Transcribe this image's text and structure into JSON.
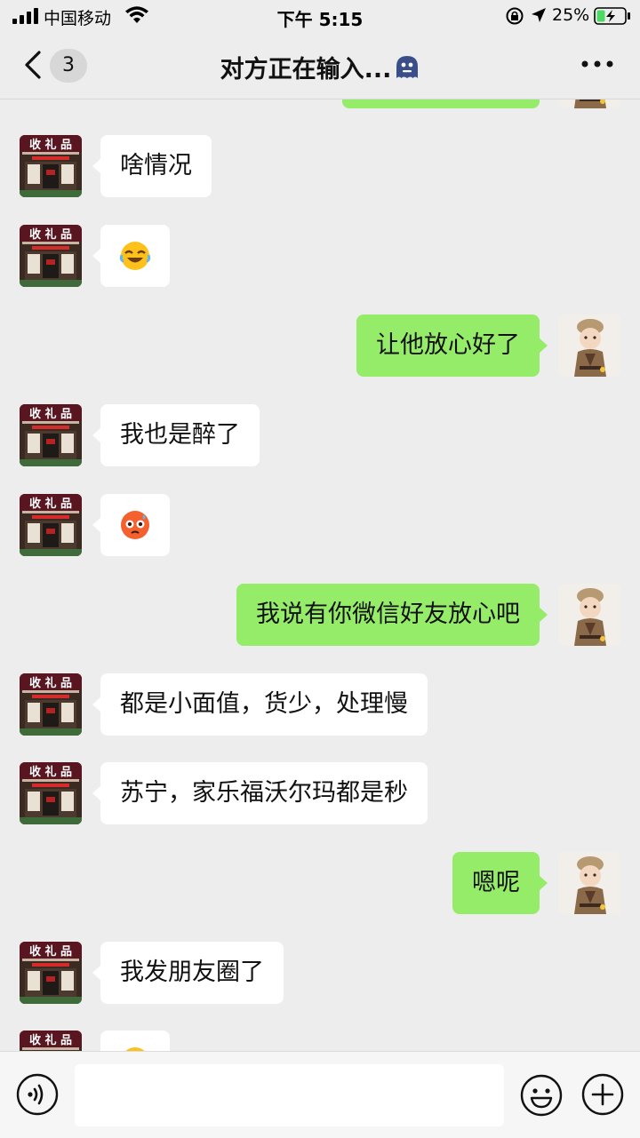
{
  "status_bar": {
    "carrier": "中国移动",
    "time": "下午 5:15",
    "battery": "25%"
  },
  "header": {
    "unread_count": "3",
    "title": "对方正在输入..."
  },
  "messages": [
    {
      "side": "in",
      "type": "text",
      "text": "啥情况"
    },
    {
      "side": "in",
      "type": "emoji",
      "emoji": "rolling-laughing-emoji"
    },
    {
      "side": "out",
      "type": "text",
      "text": "让他放心好了"
    },
    {
      "side": "in",
      "type": "text",
      "text": "我也是醉了"
    },
    {
      "side": "in",
      "type": "emoji",
      "emoji": "flushed-face-emoji"
    },
    {
      "side": "out",
      "type": "text",
      "text": "我说有你微信好友放心吧"
    },
    {
      "side": "in",
      "type": "text",
      "text": "都是小面值，货少，处理慢"
    },
    {
      "side": "in",
      "type": "text",
      "text": "苏宁，家乐福沃尔玛都是秒"
    },
    {
      "side": "out",
      "type": "text",
      "text": "嗯呢"
    },
    {
      "side": "in",
      "type": "text",
      "text": "我发朋友圈了"
    },
    {
      "side": "in",
      "type": "emoji",
      "emoji": "grinning-emoji"
    }
  ],
  "contact_avatar": {
    "sign_text": "收礼品",
    "description": "storefront sign photo"
  },
  "colors": {
    "background": "#ededed",
    "outgoing_bubble": "#95ec69",
    "incoming_bubble": "#ffffff"
  },
  "input": {
    "value": "",
    "placeholder": ""
  }
}
